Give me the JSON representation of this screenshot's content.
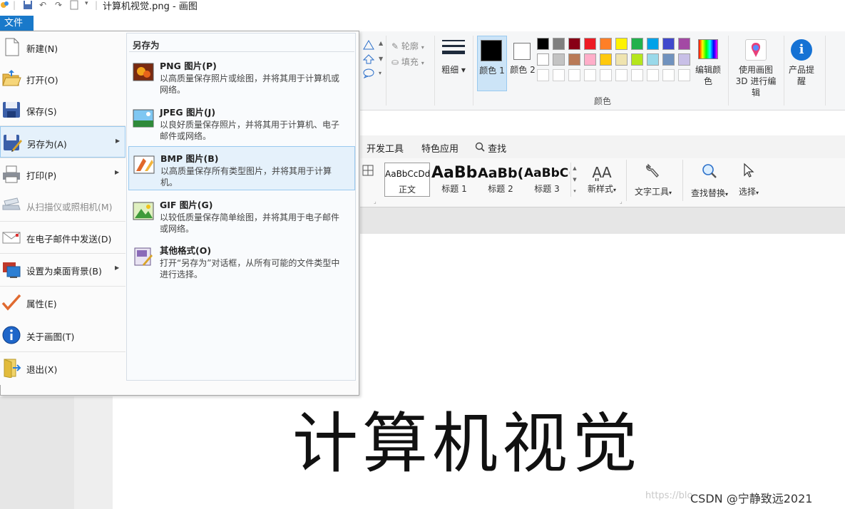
{
  "window": {
    "title": "计算机视觉.png - 画图"
  },
  "file_tab": "文件",
  "menu_left": [
    {
      "label": "新建(N)",
      "icon": "new-file-icon",
      "disabled": false,
      "submenu": false
    },
    {
      "label": "打开(O)",
      "icon": "open-folder-icon",
      "disabled": false,
      "submenu": false
    },
    {
      "label": "保存(S)",
      "icon": "save-disk-icon",
      "disabled": false,
      "submenu": false
    },
    {
      "label": "另存为(A)",
      "icon": "save-as-icon",
      "disabled": false,
      "submenu": true
    },
    {
      "label": "打印(P)",
      "icon": "printer-icon",
      "disabled": false,
      "submenu": true
    },
    {
      "label": "从扫描仪或照相机(M)",
      "icon": "scanner-icon",
      "disabled": true,
      "submenu": false
    },
    {
      "label": "在电子邮件中发送(D)",
      "icon": "email-icon",
      "disabled": false,
      "submenu": false
    },
    {
      "label": "设置为桌面背景(B)",
      "icon": "desktop-background-icon",
      "disabled": false,
      "submenu": true
    },
    {
      "label": "属性(E)",
      "icon": "checkmark-icon",
      "disabled": false,
      "submenu": false
    },
    {
      "label": "关于画图(T)",
      "icon": "info-icon",
      "disabled": false,
      "submenu": false
    },
    {
      "label": "退出(X)",
      "icon": "exit-icon",
      "disabled": false,
      "submenu": false
    }
  ],
  "saveas_panel": {
    "heading": "另存为",
    "options": [
      {
        "title": "PNG 图片(P)",
        "desc": "以高质量保存照片或绘图，并将其用于计算机或网络。",
        "icon": "png-image-icon"
      },
      {
        "title": "JPEG 图片(J)",
        "desc": "以良好质量保存照片，并将其用于计算机、电子邮件或网络。",
        "icon": "jpeg-image-icon"
      },
      {
        "title": "BMP 图片(B)",
        "desc": "以高质量保存所有类型图片，并将其用于计算机。",
        "icon": "bmp-image-icon"
      },
      {
        "title": "GIF 图片(G)",
        "desc": "以较低质量保存简单绘图，并将其用于电子邮件或网络。",
        "icon": "gif-image-icon"
      },
      {
        "title": "其他格式(O)",
        "desc": "打开“另存为”对话框，从所有可能的文件类型中进行选择。",
        "icon": "other-formats-icon"
      }
    ]
  },
  "ribbon": {
    "outline_label": "轮廓",
    "fill_label": "填充",
    "size_label": "粗细",
    "color1_label": "颜色 1",
    "color2_label": "颜色 2",
    "colors_group_label": "颜色",
    "edit_colors_label": "编辑颜色",
    "paint3d_label": "使用画图 3D 进行编辑",
    "product_alert_label": "产品提醒",
    "palette_row1": [
      "#000000",
      "#7f7f7f",
      "#880015",
      "#ed1c24",
      "#ff7f27",
      "#fff200",
      "#22b14c",
      "#00a2e8",
      "#3f48cc",
      "#a349a4"
    ],
    "palette_row2": [
      "#ffffff",
      "#c3c3c3",
      "#b97a57",
      "#ffaec9",
      "#ffc90e",
      "#efe4b0",
      "#b5e61d",
      "#99d9ea",
      "#7092be",
      "#c8bfe7"
    ],
    "color1": "#000000",
    "color2": "#ffffff"
  },
  "word": {
    "tabs": [
      "开发工具",
      "特色应用",
      "查找"
    ],
    "styles": [
      {
        "sample": "AaBbCcDd",
        "label": "正文"
      },
      {
        "sample": "AaBb",
        "label": "标题 1"
      },
      {
        "sample": "AaBb(",
        "label": "标题 2"
      },
      {
        "sample": "AaBbC(",
        "label": "标题 3"
      }
    ],
    "new_style_label": "新样式",
    "text_tools_label": "文字工具",
    "find_replace_label": "查找替换",
    "select_label": "选择"
  },
  "canvas_text": "计算机视觉",
  "watermark": "CSDN @宁静致远2021",
  "watermark_faint": "https://blo"
}
